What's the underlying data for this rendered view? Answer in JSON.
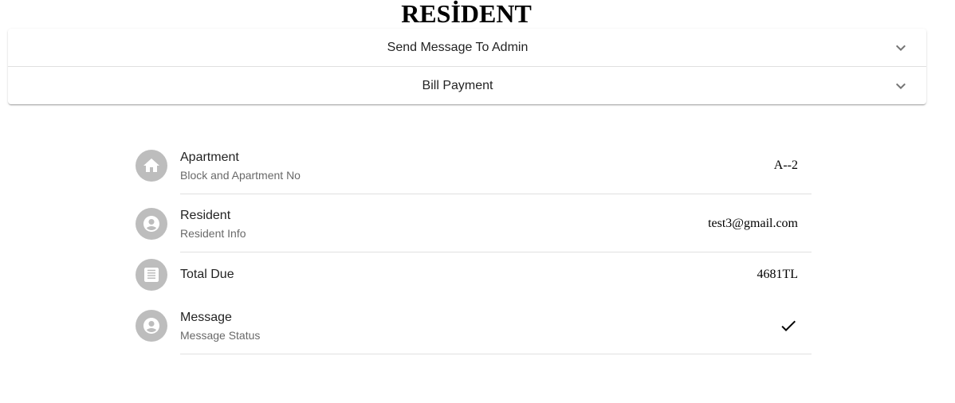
{
  "page": {
    "title": "RESİDENT"
  },
  "accordion": {
    "items": [
      {
        "label": "Send Message To Admin",
        "icon": "chevron-down-icon"
      },
      {
        "label": "Bill Payment",
        "icon": "chevron-down-icon"
      }
    ]
  },
  "info_list": {
    "apartment": {
      "icon": "home-icon",
      "primary": "Apartment",
      "secondary": "Block and Apartment No",
      "value": "A--2"
    },
    "resident": {
      "icon": "account-circle-icon",
      "primary": "Resident",
      "secondary": "Resident Info",
      "value": "test3@gmail.com"
    },
    "total_due": {
      "icon": "receipt-icon",
      "primary": "Total Due",
      "value": "4681TL"
    },
    "message": {
      "icon": "account-circle-icon",
      "primary": "Message",
      "secondary": "Message Status",
      "status_icon": "check-icon"
    }
  },
  "colors": {
    "avatar_bg": "#bdbdbd",
    "divider": "rgba(0,0,0,0.12)"
  }
}
